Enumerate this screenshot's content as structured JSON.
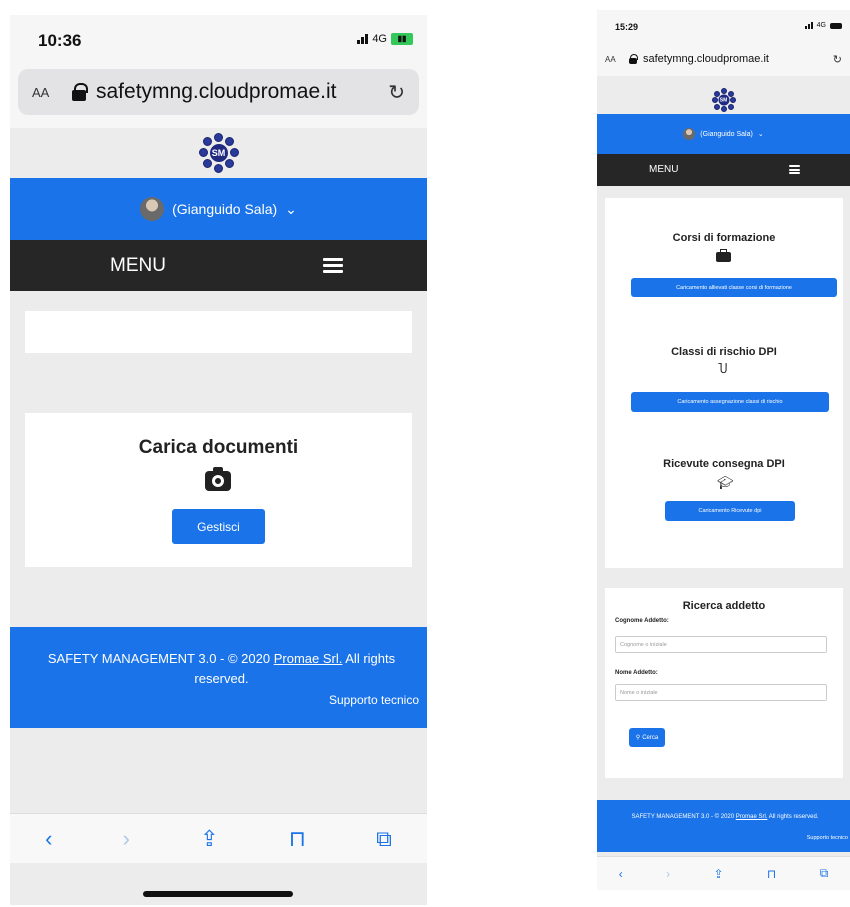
{
  "colors": {
    "primary": "#1a73e8",
    "menu_bg": "#262626",
    "page_bg": "#ececec"
  },
  "left": {
    "status": {
      "time": "10:36",
      "network": "4G"
    },
    "browser": {
      "text_size_label": "AA",
      "url": "safetymng.cloudpromae.it",
      "reload_icon": "reload-icon"
    },
    "header": {
      "logo_text": "SM",
      "user_label": "(Gianguido Sala)",
      "menu_label": "MENU"
    },
    "upload_card": {
      "title": "Carica documenti",
      "icon": "camera-icon",
      "button_label": "Gestisci"
    },
    "footer": {
      "copyright": "SAFETY MANAGEMENT 3.0 - © 2020",
      "company_link": "Promae Srl.",
      "rights": "All rights reserved.",
      "support_link": "Supporto tecnico"
    },
    "toolbar": {
      "icons": [
        "back-icon",
        "forward-icon",
        "share-icon",
        "bookmarks-icon",
        "tabs-icon"
      ]
    }
  },
  "right": {
    "status": {
      "time": "15:29",
      "network": "4G"
    },
    "browser": {
      "text_size_label": "AA",
      "url": "safetymng.cloudpromae.it"
    },
    "header": {
      "logo_text": "SM",
      "user_label": "(Gianguido Sala)",
      "menu_label": "MENU"
    },
    "sections": [
      {
        "title": "Corsi di formazione",
        "icon": "briefcase-icon",
        "button_label": "Caricamento allievati classe corsi di formazione"
      },
      {
        "title": "Classi di rischio DPI",
        "icon": "stethoscope-icon",
        "button_label": "Caricamento assegnazione classi di rischio"
      },
      {
        "title": "Ricevute consegna DPI",
        "icon": "graduation-cap-icon",
        "button_label": "Caricamento Ricevute dpi"
      }
    ],
    "search": {
      "title": "Ricerca addetto",
      "surname_label": "Cognome Addetto:",
      "surname_placeholder": "Cognome o iniziale",
      "name_label": "Nome Addetto:",
      "name_placeholder": "Nome o iniziale",
      "button_label": "Cerca"
    },
    "footer": {
      "copyright": "SAFETY MANAGEMENT 3.0 - © 2020",
      "company_link": "Promae Srl.",
      "rights": "All rights reserved.",
      "support_link": "Supporto tecnico"
    }
  }
}
